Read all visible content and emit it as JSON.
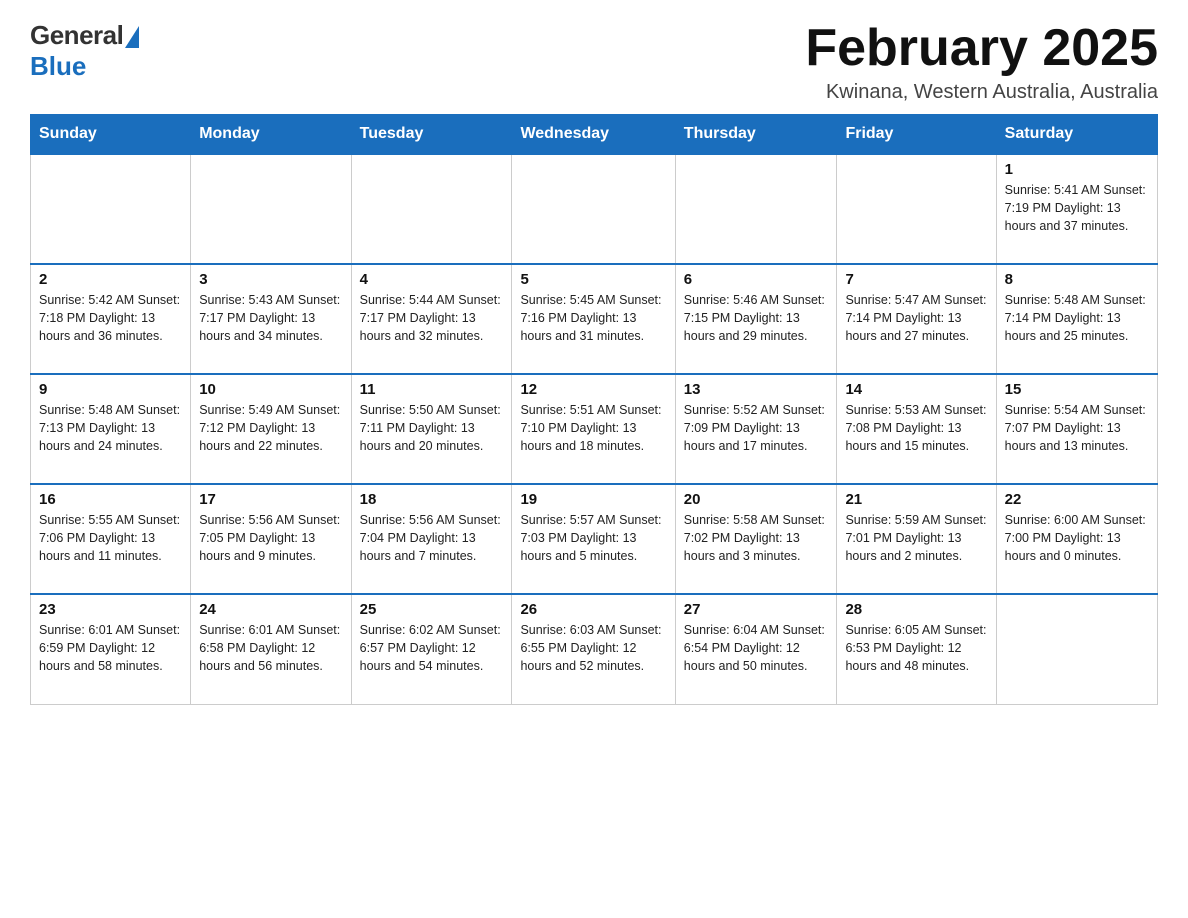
{
  "header": {
    "logo_general": "General",
    "logo_blue": "Blue",
    "month_title": "February 2025",
    "location": "Kwinana, Western Australia, Australia"
  },
  "days_of_week": [
    "Sunday",
    "Monday",
    "Tuesday",
    "Wednesday",
    "Thursday",
    "Friday",
    "Saturday"
  ],
  "weeks": [
    [
      {
        "day": "",
        "info": ""
      },
      {
        "day": "",
        "info": ""
      },
      {
        "day": "",
        "info": ""
      },
      {
        "day": "",
        "info": ""
      },
      {
        "day": "",
        "info": ""
      },
      {
        "day": "",
        "info": ""
      },
      {
        "day": "1",
        "info": "Sunrise: 5:41 AM\nSunset: 7:19 PM\nDaylight: 13 hours and 37 minutes."
      }
    ],
    [
      {
        "day": "2",
        "info": "Sunrise: 5:42 AM\nSunset: 7:18 PM\nDaylight: 13 hours and 36 minutes."
      },
      {
        "day": "3",
        "info": "Sunrise: 5:43 AM\nSunset: 7:17 PM\nDaylight: 13 hours and 34 minutes."
      },
      {
        "day": "4",
        "info": "Sunrise: 5:44 AM\nSunset: 7:17 PM\nDaylight: 13 hours and 32 minutes."
      },
      {
        "day": "5",
        "info": "Sunrise: 5:45 AM\nSunset: 7:16 PM\nDaylight: 13 hours and 31 minutes."
      },
      {
        "day": "6",
        "info": "Sunrise: 5:46 AM\nSunset: 7:15 PM\nDaylight: 13 hours and 29 minutes."
      },
      {
        "day": "7",
        "info": "Sunrise: 5:47 AM\nSunset: 7:14 PM\nDaylight: 13 hours and 27 minutes."
      },
      {
        "day": "8",
        "info": "Sunrise: 5:48 AM\nSunset: 7:14 PM\nDaylight: 13 hours and 25 minutes."
      }
    ],
    [
      {
        "day": "9",
        "info": "Sunrise: 5:48 AM\nSunset: 7:13 PM\nDaylight: 13 hours and 24 minutes."
      },
      {
        "day": "10",
        "info": "Sunrise: 5:49 AM\nSunset: 7:12 PM\nDaylight: 13 hours and 22 minutes."
      },
      {
        "day": "11",
        "info": "Sunrise: 5:50 AM\nSunset: 7:11 PM\nDaylight: 13 hours and 20 minutes."
      },
      {
        "day": "12",
        "info": "Sunrise: 5:51 AM\nSunset: 7:10 PM\nDaylight: 13 hours and 18 minutes."
      },
      {
        "day": "13",
        "info": "Sunrise: 5:52 AM\nSunset: 7:09 PM\nDaylight: 13 hours and 17 minutes."
      },
      {
        "day": "14",
        "info": "Sunrise: 5:53 AM\nSunset: 7:08 PM\nDaylight: 13 hours and 15 minutes."
      },
      {
        "day": "15",
        "info": "Sunrise: 5:54 AM\nSunset: 7:07 PM\nDaylight: 13 hours and 13 minutes."
      }
    ],
    [
      {
        "day": "16",
        "info": "Sunrise: 5:55 AM\nSunset: 7:06 PM\nDaylight: 13 hours and 11 minutes."
      },
      {
        "day": "17",
        "info": "Sunrise: 5:56 AM\nSunset: 7:05 PM\nDaylight: 13 hours and 9 minutes."
      },
      {
        "day": "18",
        "info": "Sunrise: 5:56 AM\nSunset: 7:04 PM\nDaylight: 13 hours and 7 minutes."
      },
      {
        "day": "19",
        "info": "Sunrise: 5:57 AM\nSunset: 7:03 PM\nDaylight: 13 hours and 5 minutes."
      },
      {
        "day": "20",
        "info": "Sunrise: 5:58 AM\nSunset: 7:02 PM\nDaylight: 13 hours and 3 minutes."
      },
      {
        "day": "21",
        "info": "Sunrise: 5:59 AM\nSunset: 7:01 PM\nDaylight: 13 hours and 2 minutes."
      },
      {
        "day": "22",
        "info": "Sunrise: 6:00 AM\nSunset: 7:00 PM\nDaylight: 13 hours and 0 minutes."
      }
    ],
    [
      {
        "day": "23",
        "info": "Sunrise: 6:01 AM\nSunset: 6:59 PM\nDaylight: 12 hours and 58 minutes."
      },
      {
        "day": "24",
        "info": "Sunrise: 6:01 AM\nSunset: 6:58 PM\nDaylight: 12 hours and 56 minutes."
      },
      {
        "day": "25",
        "info": "Sunrise: 6:02 AM\nSunset: 6:57 PM\nDaylight: 12 hours and 54 minutes."
      },
      {
        "day": "26",
        "info": "Sunrise: 6:03 AM\nSunset: 6:55 PM\nDaylight: 12 hours and 52 minutes."
      },
      {
        "day": "27",
        "info": "Sunrise: 6:04 AM\nSunset: 6:54 PM\nDaylight: 12 hours and 50 minutes."
      },
      {
        "day": "28",
        "info": "Sunrise: 6:05 AM\nSunset: 6:53 PM\nDaylight: 12 hours and 48 minutes."
      },
      {
        "day": "",
        "info": ""
      }
    ]
  ]
}
